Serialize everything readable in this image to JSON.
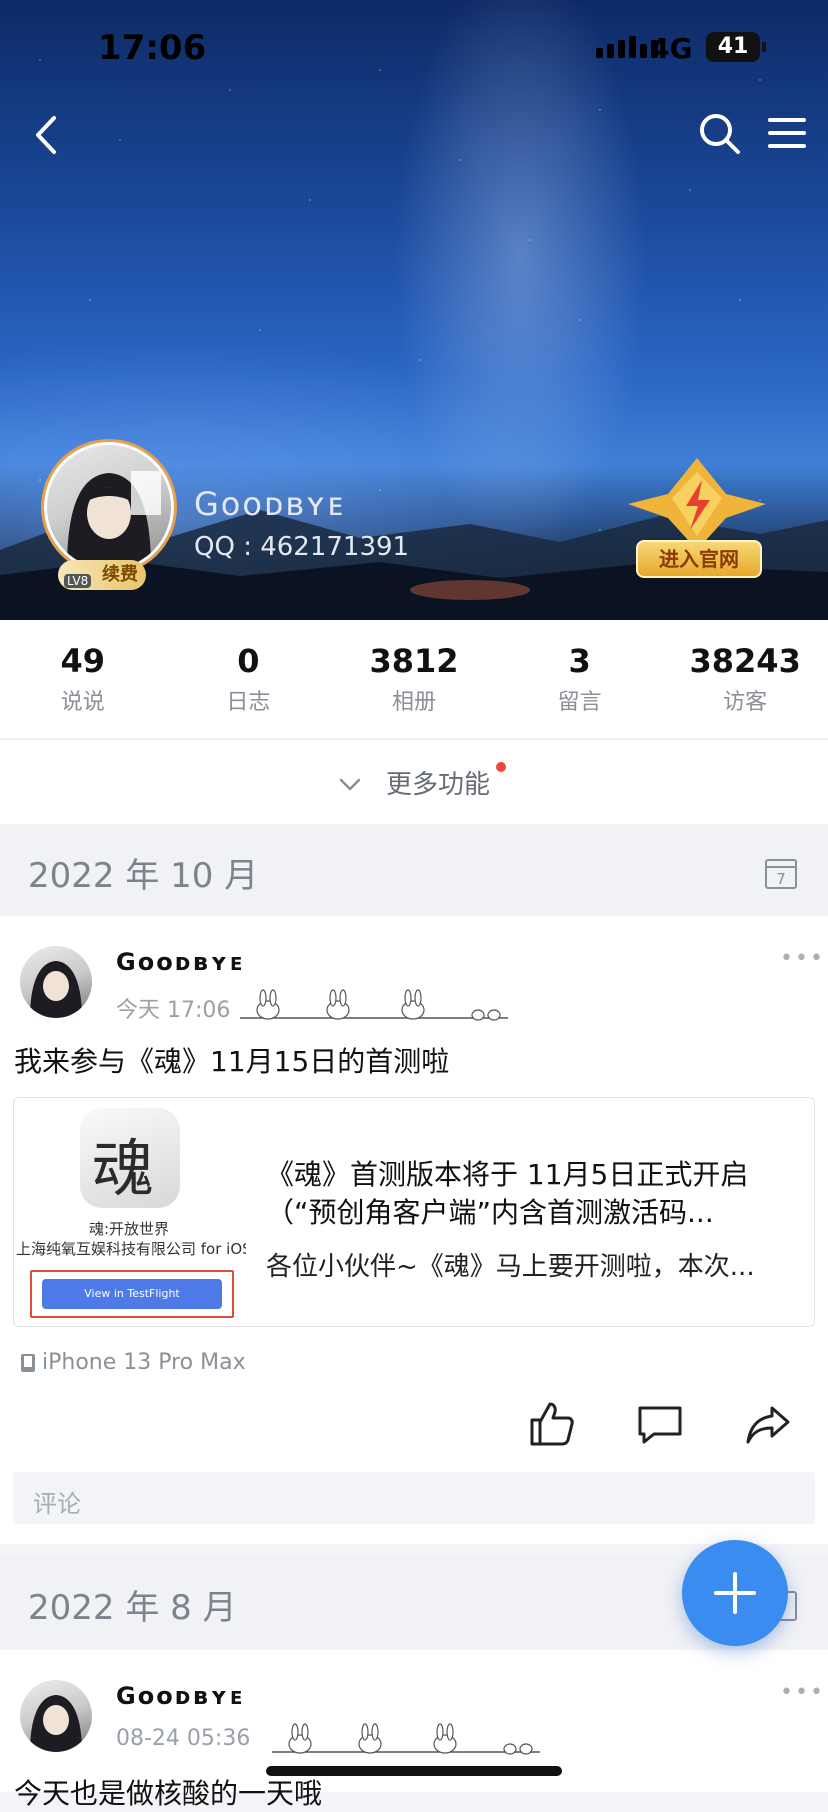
{
  "status_bar": {
    "time": "17:06",
    "network": "4G",
    "battery": "41"
  },
  "profile": {
    "name": "Gᴏᴏᴅʙʏᴇ",
    "qq": "QQ : 462171391",
    "renew_badge": "续费",
    "level": "LV8",
    "official_badge": "进入官网"
  },
  "stats": [
    {
      "value": "49",
      "label": "说说"
    },
    {
      "value": "0",
      "label": "日志"
    },
    {
      "value": "3812",
      "label": "相册"
    },
    {
      "value": "3",
      "label": "留言"
    },
    {
      "value": "38243",
      "label": "访客"
    }
  ],
  "more_functions": {
    "label": "更多功能"
  },
  "calendar_day": "7",
  "sections": [
    {
      "month": "2022 年 10 月"
    },
    {
      "month": "2022 年 8 月"
    }
  ],
  "posts": [
    {
      "author": "Gᴏᴏᴅʙʏᴇ",
      "time": "今天 17:06",
      "text": "我来参与《魂》11月15日的首测啦",
      "share_card": {
        "app_icon_char": "魂",
        "app_name": "魂:开放世界",
        "app_developer": "上海纯氧互娱科技有限公司 for iOS",
        "button_label": "View in TestFlight",
        "title": "《魂》首测版本将于 11月5日正式开启（“预创角客户端”内含首测激活码...",
        "desc": "各位小伙伴~《魂》马上要开测啦，本次..."
      },
      "device": "iPhone 13 Pro Max",
      "comment_placeholder": "评论"
    },
    {
      "author": "Gᴏᴏᴅʙʏᴇ",
      "time": "08-24 05:36",
      "text": "今天也是做核酸的一天哦"
    }
  ],
  "colors": {
    "accent": "#3b8cf0",
    "notification_dot": "#f0473d",
    "highlight_frame": "#e04b3a"
  }
}
